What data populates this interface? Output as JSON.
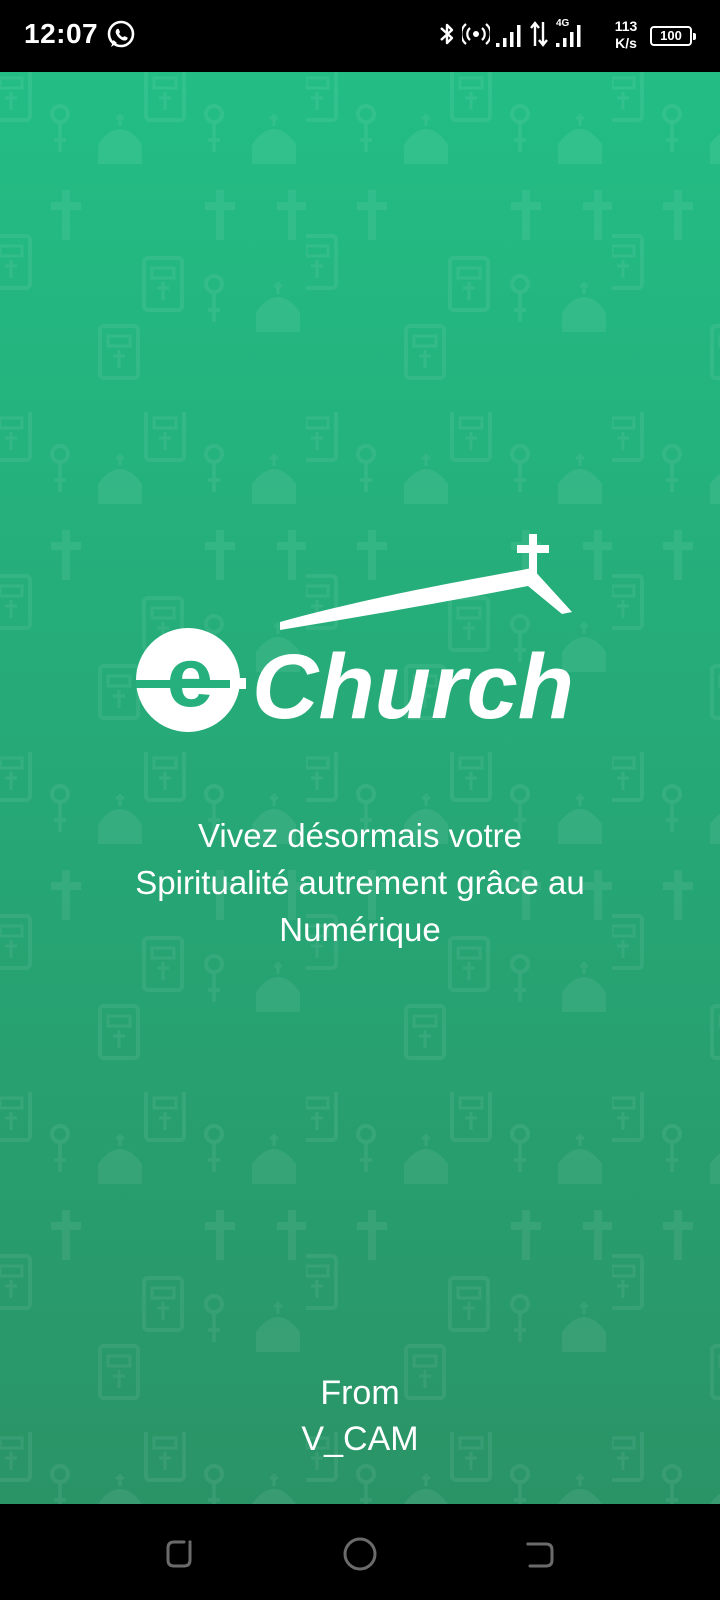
{
  "status_bar": {
    "time": "12:07",
    "left_icons": [
      "whatsapp-icon"
    ],
    "right_icons": [
      "bluetooth-icon",
      "hotspot-icon",
      "signal-icon",
      "data-arrows-icon",
      "signal-4g-icon"
    ],
    "network_type": "4G",
    "net_speed_value": "113",
    "net_speed_unit": "K/s",
    "battery_level": "100"
  },
  "splash": {
    "background_color": "#25b07d",
    "pattern_icons": [
      "bible-icon",
      "rosary-icon",
      "church-icon",
      "cross-icon"
    ],
    "logo": {
      "prefix": "e",
      "name": "Church"
    },
    "tagline_lines": [
      "Vivez désormais votre",
      "Spiritualité autrement grâce au",
      "Numérique"
    ],
    "from_label": "From",
    "company": "V_CAM"
  },
  "nav_bar": {
    "buttons": [
      "recents-button",
      "home-button",
      "back-button"
    ]
  }
}
